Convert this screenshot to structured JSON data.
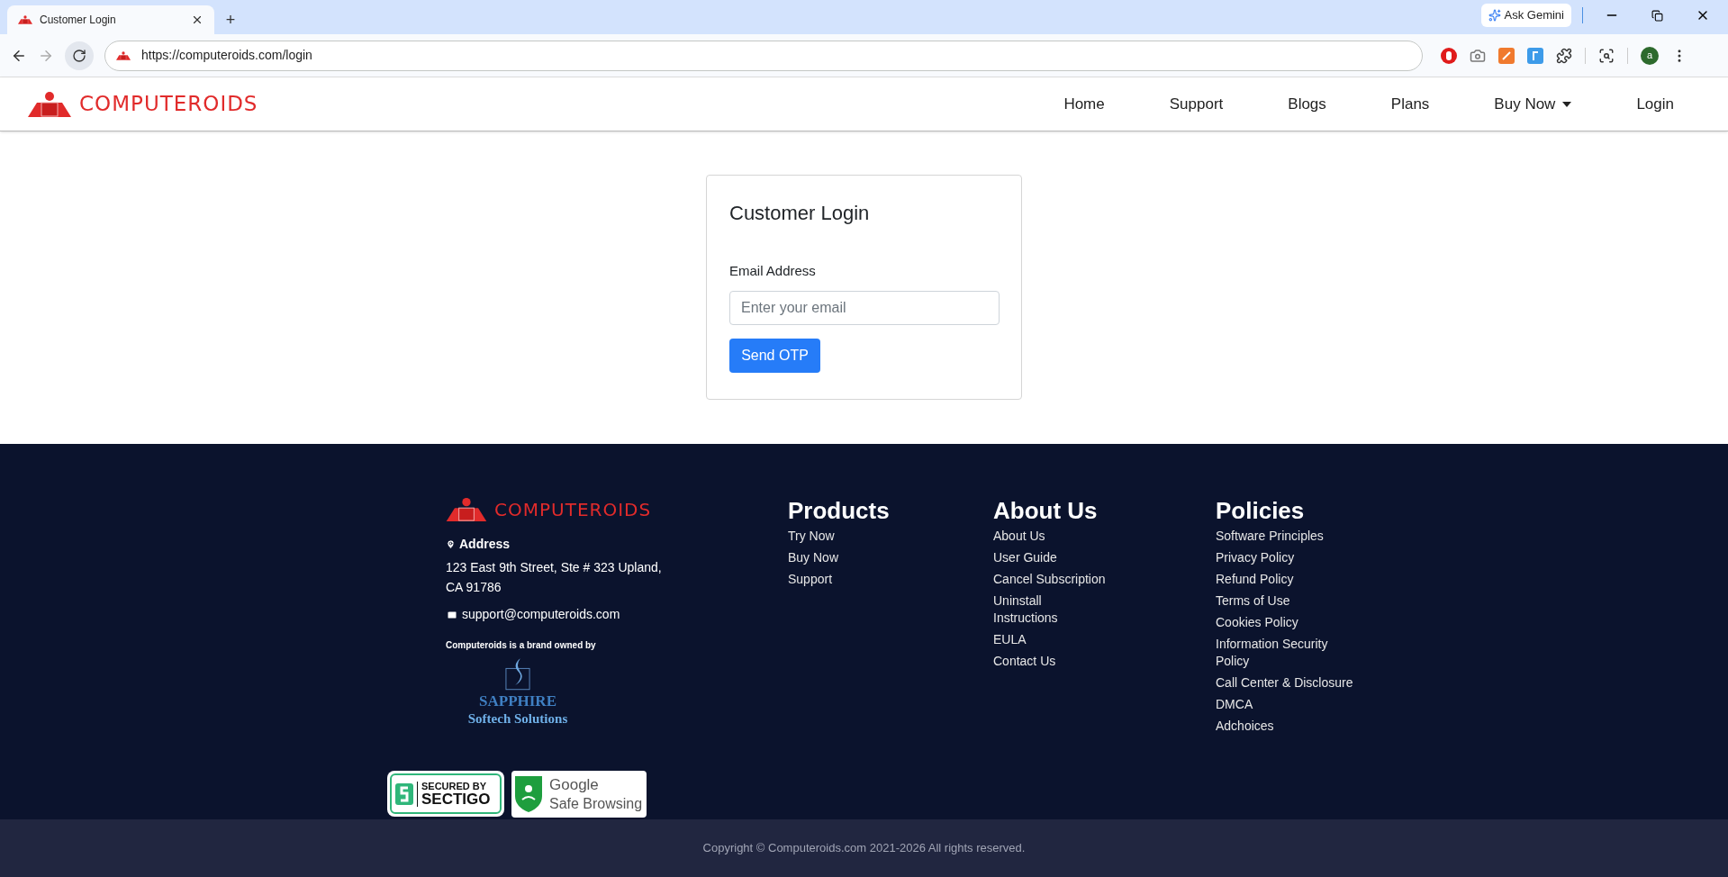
{
  "browser": {
    "tab": {
      "title": "Customer Login",
      "selected": true
    },
    "new_tab": "+",
    "ask_gemini": "Ask Gemini",
    "url": "https://computeroids.com/login",
    "profile": "a"
  },
  "header": {
    "logo": "COMPUTEROIDS",
    "nav": [
      {
        "label": "Home",
        "kind": "link"
      },
      {
        "label": "Support",
        "kind": "link"
      },
      {
        "label": "Blogs",
        "kind": "link"
      },
      {
        "label": "Plans",
        "kind": "link"
      },
      {
        "label": "Buy Now",
        "kind": "dropdown"
      },
      {
        "label": "Login",
        "kind": "link"
      }
    ]
  },
  "login": {
    "title": "Customer Login",
    "email_label": "Email Address",
    "email_placeholder": "Enter your email",
    "button": "Send OTP"
  },
  "footer": {
    "logo": "COMPUTEROIDS",
    "address_heading": "Address",
    "address": "123 East 9th Street, Ste # 323 Upland, CA 91786",
    "email": "support@computeroids.com",
    "brand_note": "Computeroids is a brand owned by",
    "owner": {
      "name": "SAPPHIRE",
      "subtitle": "Softech Solutions"
    },
    "columns": [
      {
        "title": "Products",
        "links": [
          "Try Now",
          "Buy Now",
          "Support"
        ]
      },
      {
        "title": "About Us",
        "links": [
          "About Us",
          "User Guide",
          "Cancel Subscription",
          "Uninstall Instructions",
          "EULA",
          "Contact Us"
        ]
      },
      {
        "title": "Policies",
        "links": [
          "Software Principles",
          "Privacy Policy",
          "Refund Policy",
          "Terms of Use",
          "Cookies Policy",
          "Information Security Policy",
          "Call Center & Disclosure",
          "DMCA",
          "Adchoices"
        ]
      }
    ],
    "badges": [
      {
        "kind": "sectigo",
        "lines": [
          "SECURED BY",
          "SECTIGO"
        ]
      },
      {
        "kind": "google",
        "lines": [
          "Google",
          "Safe Browsing"
        ]
      }
    ],
    "copyright": "Copyright © Computeroids.com 2021-2026 All rights reserved."
  }
}
